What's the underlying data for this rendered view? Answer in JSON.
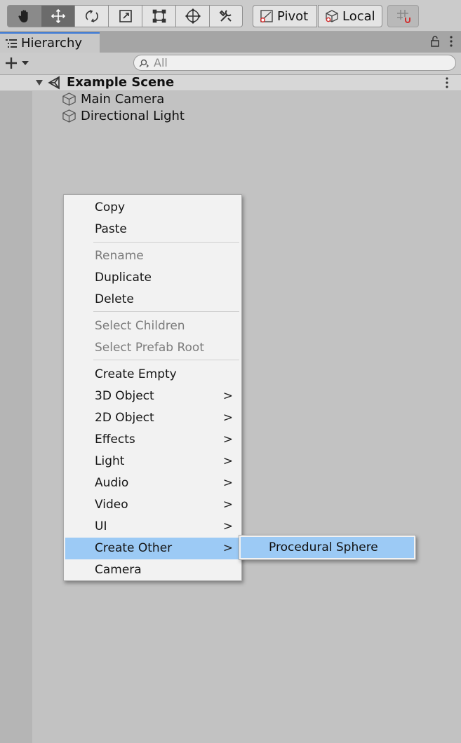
{
  "toolbar": {
    "tools": [
      "hand-icon",
      "move-icon",
      "rotate-icon",
      "scale-icon",
      "rect-icon",
      "transform-icon",
      "custom-tool-icon"
    ],
    "pivot_label": "Pivot",
    "local_label": "Local"
  },
  "hierarchy": {
    "tab_label": "Hierarchy",
    "search_placeholder": "All",
    "scene_name": "Example Scene",
    "objects": [
      "Main Camera",
      "Directional Light"
    ]
  },
  "context_menu": {
    "items": [
      {
        "label": "Copy"
      },
      {
        "label": "Paste"
      },
      {
        "label": "Rename"
      },
      {
        "label": "Duplicate"
      },
      {
        "label": "Delete"
      },
      {
        "label": "Select Children"
      },
      {
        "label": "Select Prefab Root"
      },
      {
        "label": "Create Empty"
      },
      {
        "label": "3D Object"
      },
      {
        "label": "2D Object"
      },
      {
        "label": "Effects"
      },
      {
        "label": "Light"
      },
      {
        "label": "Audio"
      },
      {
        "label": "Video"
      },
      {
        "label": "UI"
      },
      {
        "label": "Create Other"
      },
      {
        "label": "Camera"
      }
    ],
    "submenu_chevron": ">",
    "highlight_color": "#9ccaf5"
  },
  "submenu": {
    "items": [
      {
        "label": "Procedural Sphere"
      }
    ]
  }
}
